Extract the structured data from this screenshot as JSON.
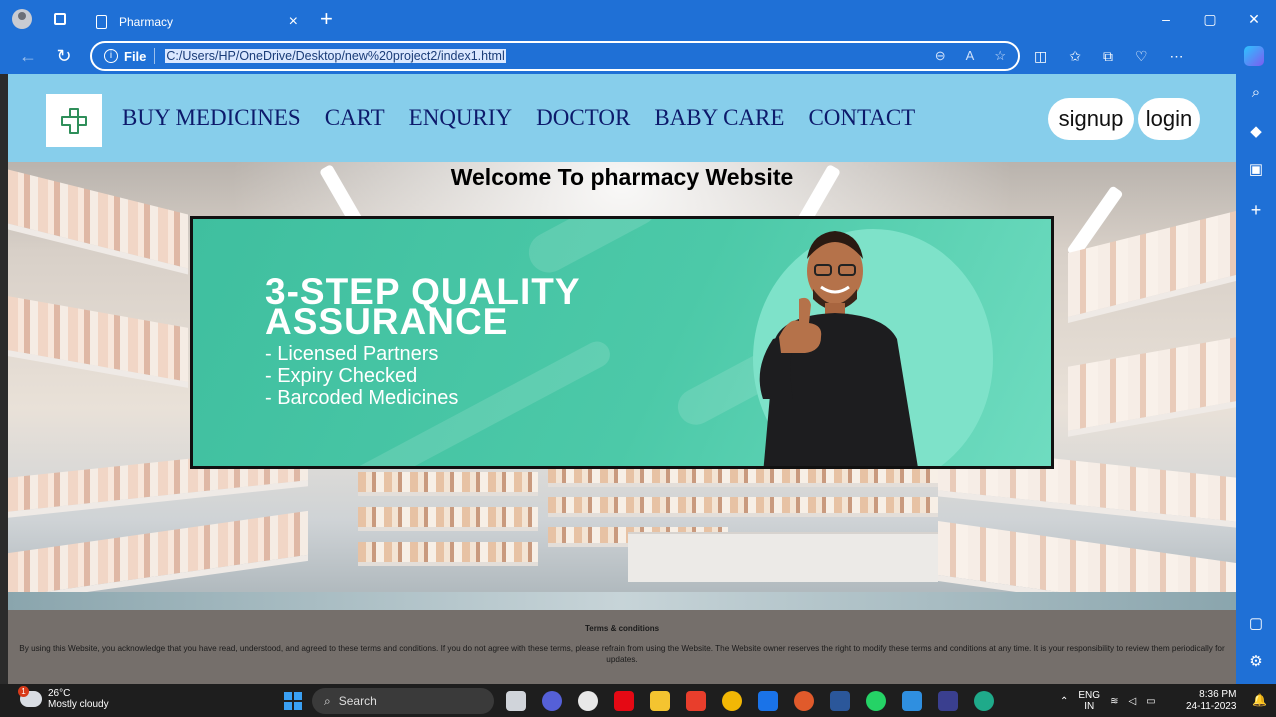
{
  "browser": {
    "tab_title": "Pharmacy",
    "tab_close": "×",
    "new_tab": "+",
    "address_scheme": "File",
    "address_url": "C:/Users/HP/OneDrive/Desktop/new%20project2/index1.html",
    "window_min": "–",
    "window_max": "▢",
    "window_close": "✕"
  },
  "site": {
    "nav": [
      "BUY MEDICINES",
      "CART",
      "ENQURIY",
      "DOCTOR",
      "BABY CARE",
      "CONTACT"
    ],
    "signup": "signup",
    "login": "login",
    "welcome": "Welcome To pharmacy Website",
    "banner": {
      "heading_line1": "3-STEP QUALITY",
      "heading_line2": "ASSURANCE",
      "bullets": [
        "- Licensed Partners",
        "- Expiry Checked",
        "- Barcoded Medicines"
      ],
      "bg_color": "#4cc9a8"
    },
    "footer_title": "Terms & conditions",
    "footer_text": "By using this Website, you acknowledge that you have read, understood, and agreed to these terms and conditions. If you do not agree with these terms, please refrain from using the Website. The Website owner reserves the right to modify these terms and conditions at any time. It is your responsibility to review them periodically for updates.",
    "nav_bg": "#87ceeb",
    "nav_text_color": "#0d1a6b"
  },
  "taskbar": {
    "temp": "26°C",
    "weather": "Mostly cloudy",
    "weather_badge": "1",
    "search": "Search",
    "lang": "ENG",
    "region": "IN",
    "time": "8:36 PM",
    "date": "24-11-2023"
  }
}
